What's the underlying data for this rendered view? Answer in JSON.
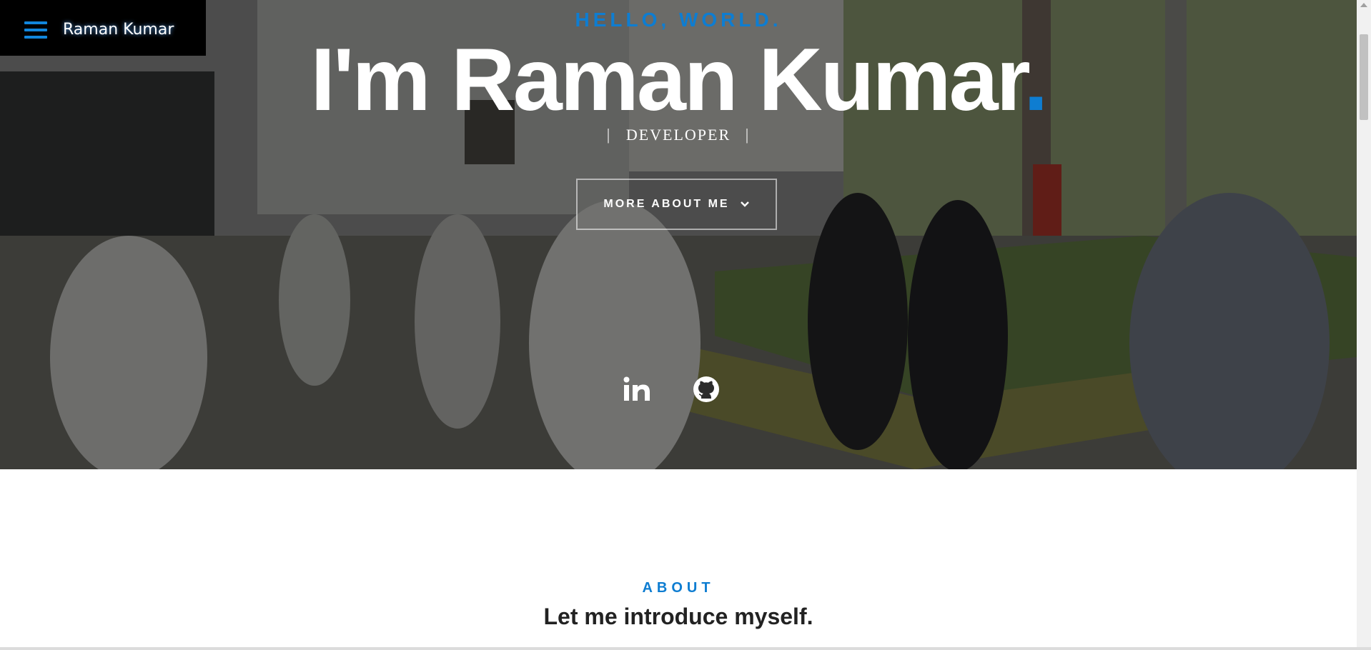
{
  "nav": {
    "menu_icon": "hamburger-icon",
    "brand": "Raman Kumar"
  },
  "hero": {
    "pretitle": "HELLO, WORLD.",
    "name": "I'm Raman Kumar",
    "name_dot": ".",
    "role_separator": "|",
    "role": "DEVELOPER",
    "cta_label": "MORE ABOUT ME",
    "cta_icon": "chevron-down-icon",
    "social": [
      {
        "icon": "linkedin-icon"
      },
      {
        "icon": "github-icon"
      }
    ]
  },
  "about": {
    "label": "ABOUT",
    "heading": "Let me introduce myself."
  },
  "colors": {
    "accent": "#0e7dd1",
    "nav_bg": "#000000",
    "text_dark": "#222222"
  }
}
